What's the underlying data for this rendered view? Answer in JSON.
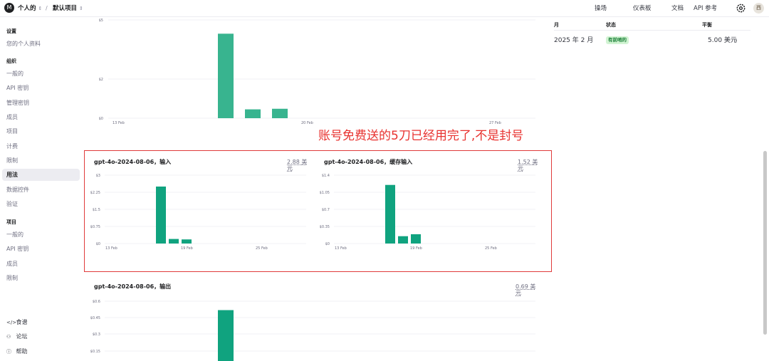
{
  "topbar": {
    "logo": "M",
    "org": "个人的",
    "separator": "/",
    "project": "默认项目",
    "links": [
      "操场",
      "仪表板",
      "文档",
      "API 参考"
    ],
    "avatar": "西"
  },
  "sidebar": {
    "settings_heading": "设置",
    "profile": "您的个人资料",
    "org_heading": "组织",
    "org_items": [
      "一般的",
      "API 密钥",
      "管理密钥",
      "成员",
      "项目",
      "计费",
      "限制",
      "用法",
      "数据控件",
      "验证"
    ],
    "active_item": "用法",
    "project_heading": "项目",
    "project_items": [
      "一般的",
      "API 密钥",
      "成员",
      "限制"
    ],
    "footer": [
      {
        "icon": "code-icon",
        "label": "食谱"
      },
      {
        "icon": "forum-icon",
        "label": "论坛"
      },
      {
        "icon": "help-icon",
        "label": "帮助"
      }
    ]
  },
  "annotation": "账号免费送的5刀已经用完了,不是封号",
  "cards": [
    {
      "title": "gpt-4o-2024-08-06，输入",
      "cost": "2.88 美元"
    },
    {
      "title": "gpt-4o-2024-08-06，缓存输入",
      "cost": "1.52 美元"
    },
    {
      "title": "gpt-4o-2024-08-06，输出",
      "cost": "0.69 美元"
    }
  ],
  "chart_data": [
    {
      "type": "bar",
      "title": "",
      "y_ticks": [
        "$0",
        "$2",
        "$5"
      ],
      "x_ticks": [
        "13 Feb",
        "20 Feb",
        "27 Feb"
      ],
      "categories": [
        "16 Feb",
        "17 Feb",
        "18 Feb"
      ],
      "values": [
        4.3,
        0.45,
        0.48
      ],
      "ylim": [
        0,
        5
      ]
    },
    {
      "type": "bar",
      "title": "gpt-4o-2024-08-06，输入",
      "y_ticks": [
        "$0",
        "$0.75",
        "$1.5",
        "$2.25",
        "$3"
      ],
      "x_ticks": [
        "13 Feb",
        "19 Feb",
        "25 Feb"
      ],
      "categories": [
        "17 Feb",
        "18 Feb",
        "19 Feb"
      ],
      "values": [
        2.5,
        0.2,
        0.18
      ],
      "ylim": [
        0,
        3
      ]
    },
    {
      "type": "bar",
      "title": "gpt-4o-2024-08-06，缓存输入",
      "y_ticks": [
        "$0",
        "$0.35",
        "$0.7",
        "$1.05",
        "$1.4"
      ],
      "x_ticks": [
        "13 Feb",
        "19 Feb",
        "25 Feb"
      ],
      "categories": [
        "17 Feb",
        "18 Feb",
        "19 Feb"
      ],
      "values": [
        1.2,
        0.15,
        0.19
      ],
      "ylim": [
        0,
        1.4
      ]
    },
    {
      "type": "bar",
      "title": "gpt-4o-2024-08-06，输出",
      "y_ticks": [
        "$0.15",
        "$0.3",
        "$0.45",
        "$0.6"
      ],
      "categories": [
        "16 Feb",
        "17 Feb",
        "18 Feb"
      ],
      "values": [
        0.52,
        0.02,
        0.03
      ],
      "ylim": [
        0,
        0.6
      ]
    }
  ],
  "credits": {
    "headers": [
      "月",
      "状态",
      "平衡"
    ],
    "rows": [
      {
        "month": "2025 年 2 月",
        "status": "有前哨的",
        "balance": "5.00 美元"
      }
    ]
  },
  "colors": {
    "bar_top": "#38b48f",
    "bar": "#10a37f",
    "highlight": "#e03b3b"
  }
}
